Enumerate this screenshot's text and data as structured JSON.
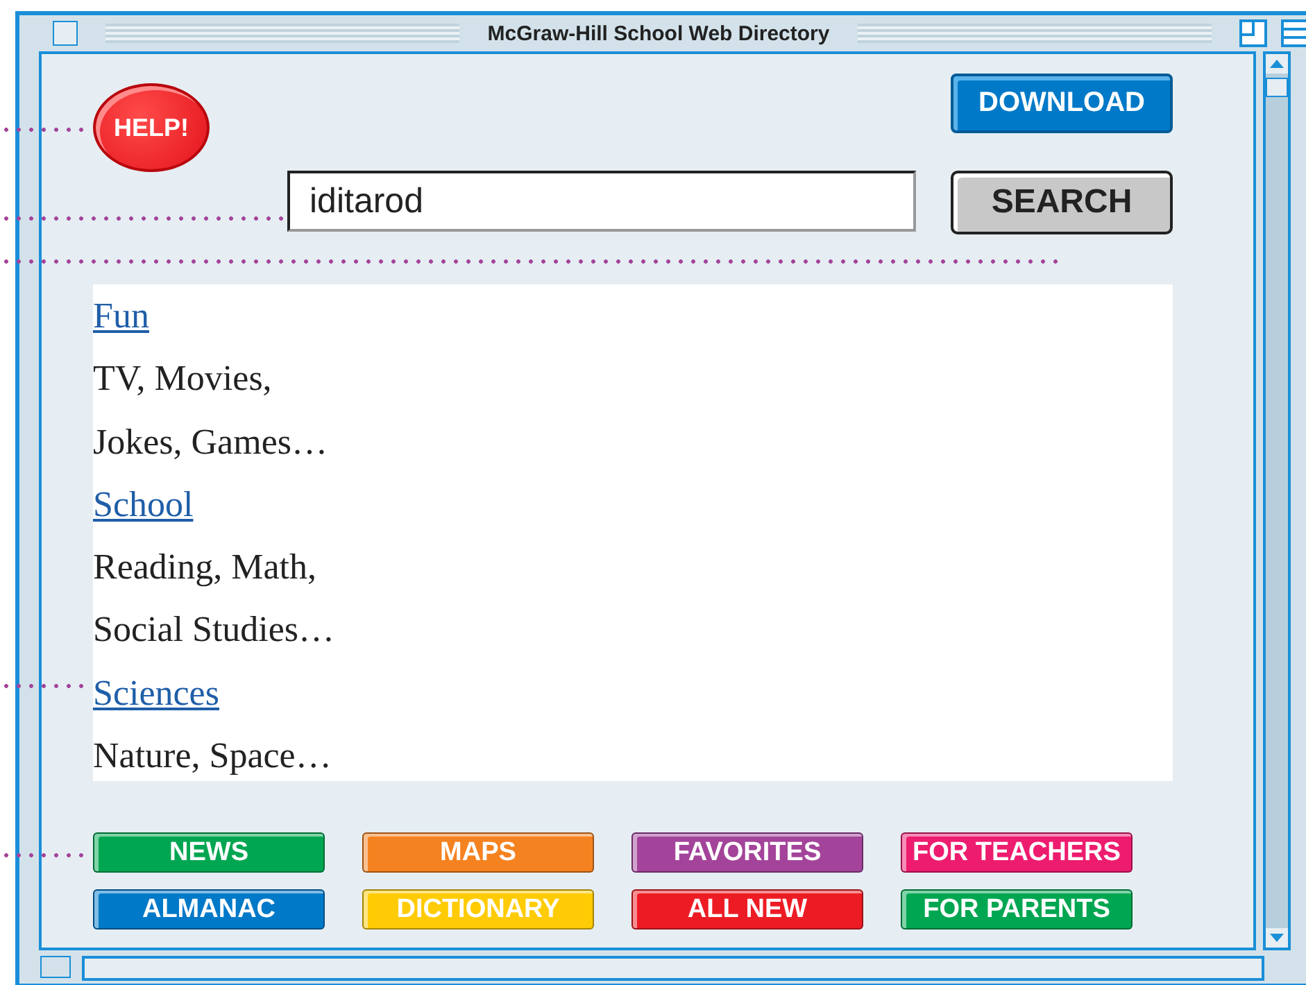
{
  "window": {
    "title": "McGraw-Hill School Web Directory"
  },
  "help_button": {
    "label": "HELP!"
  },
  "download_button": {
    "label": "DOWNLOAD"
  },
  "search": {
    "value": "iditarod",
    "button": "SEARCH"
  },
  "results": [
    {
      "kind": "link",
      "text": "Fun"
    },
    {
      "kind": "text",
      "text": "TV, Movies,"
    },
    {
      "kind": "text",
      "text": "Jokes, Games…"
    },
    {
      "kind": "link",
      "text": "School"
    },
    {
      "kind": "text",
      "text": "Reading, Math,"
    },
    {
      "kind": "text",
      "text": "Social Studies…"
    },
    {
      "kind": "link",
      "text": "Sciences"
    },
    {
      "kind": "text",
      "text": "Nature, Space…"
    }
  ],
  "nav_buttons": [
    {
      "label": "NEWS",
      "color": "#00a651"
    },
    {
      "label": "MAPS",
      "color": "#f58220"
    },
    {
      "label": "FAVORITES",
      "color": "#a3449a"
    },
    {
      "label": "FOR TEACHERS",
      "color": "#ed1c6f"
    },
    {
      "label": "ALMANAC",
      "color": "#0079c8"
    },
    {
      "label": "DICTIONARY",
      "color": "#ffcb05"
    },
    {
      "label": "ALL NEW",
      "color": "#ed1c24"
    },
    {
      "label": "FOR PARENTS",
      "color": "#00a651"
    }
  ]
}
